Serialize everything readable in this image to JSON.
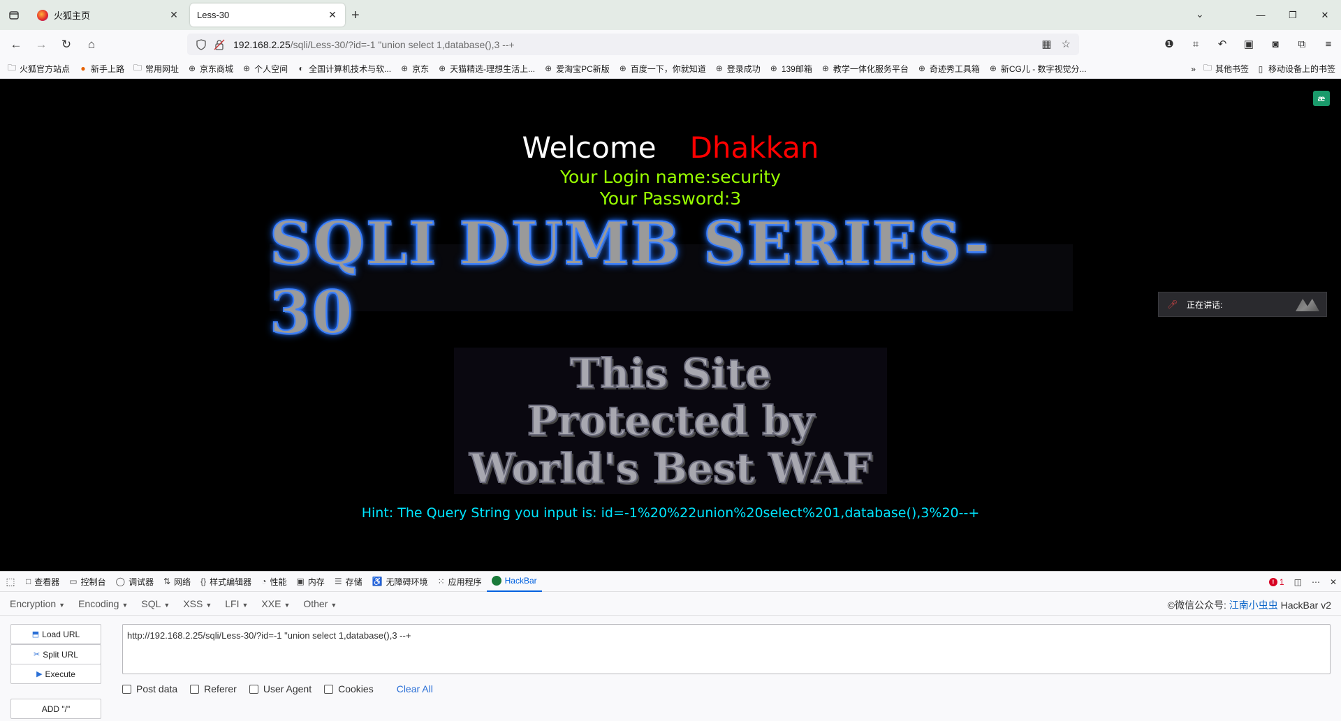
{
  "tabs": [
    {
      "title": "火狐主页",
      "active": false
    },
    {
      "title": "Less-30",
      "active": true
    }
  ],
  "url": {
    "host": "192.168.2.25",
    "rest": "/sqli/Less-30/?id=-1 \"union select 1,database(),3 --+"
  },
  "bookmarks": [
    {
      "label": "火狐官方站点",
      "icon": "folder-icon"
    },
    {
      "label": "新手上路",
      "icon": "firefox-icon"
    },
    {
      "label": "常用网址",
      "icon": "folder-icon"
    },
    {
      "label": "京东商城",
      "icon": "globe-icon"
    },
    {
      "label": "个人空间",
      "icon": "globe-icon"
    },
    {
      "label": "全国计算机技术与软...",
      "icon": "site-icon"
    },
    {
      "label": "京东",
      "icon": "globe-icon"
    },
    {
      "label": "天猫精选-理想生活上...",
      "icon": "globe-icon"
    },
    {
      "label": "爱淘宝PC新版",
      "icon": "globe-icon"
    },
    {
      "label": "百度一下，你就知道",
      "icon": "globe-icon"
    },
    {
      "label": "登录成功",
      "icon": "globe-icon"
    },
    {
      "label": "139邮箱",
      "icon": "globe-icon"
    },
    {
      "label": "教学一体化服务平台",
      "icon": "globe-icon"
    },
    {
      "label": "奇迹秀工具箱",
      "icon": "globe-icon"
    },
    {
      "label": "新CG儿 - 数字视觉分...",
      "icon": "globe-icon"
    }
  ],
  "bookmarks_right": {
    "other": "其他书签",
    "mobile": "移动设备上的书签"
  },
  "page": {
    "welcome": "Welcome",
    "name": "Dhakkan",
    "login_name": "Your Login name:security",
    "password": "Your Password:3",
    "banner": "SQLI DUMB SERIES-30",
    "waf_lines": [
      "This Site",
      "Protected by",
      "World's Best WAF"
    ],
    "hint": "Hint: The Query String you input is: id=-1%20%22union%20select%201,database(),3%20--+",
    "ext_badge": "æ",
    "speaking": "正在讲话:"
  },
  "devtools": {
    "tabs": [
      {
        "label": "查看器",
        "icon": "□"
      },
      {
        "label": "控制台",
        "icon": "▭"
      },
      {
        "label": "调试器",
        "icon": "◯"
      },
      {
        "label": "网络",
        "icon": "⇅"
      },
      {
        "label": "样式编辑器",
        "icon": "{}"
      },
      {
        "label": "性能",
        "icon": "◔"
      },
      {
        "label": "内存",
        "icon": "▣"
      },
      {
        "label": "存储",
        "icon": "☰"
      },
      {
        "label": "无障碍环境",
        "icon": "♿"
      },
      {
        "label": "应用程序",
        "icon": "⁙"
      },
      {
        "label": "HackBar",
        "icon": ""
      }
    ],
    "error_count": "1"
  },
  "hackbar": {
    "menus": [
      "Encryption",
      "Encoding",
      "SQL",
      "XSS",
      "LFI",
      "XXE",
      "Other"
    ],
    "credit_prefix": "©微信公众号: ",
    "credit_name": "江南小虫虫",
    "credit_suffix": " HackBar v2",
    "buttons": [
      "Load URL",
      "Split URL",
      "Execute",
      "ADD \"/\""
    ],
    "url_value": "http://192.168.2.25/sqli/Less-30/?id=-1 \"union select 1,database(),3 --+",
    "options": [
      "Post data",
      "Referer",
      "User Agent",
      "Cookies"
    ],
    "clear_all": "Clear All"
  }
}
